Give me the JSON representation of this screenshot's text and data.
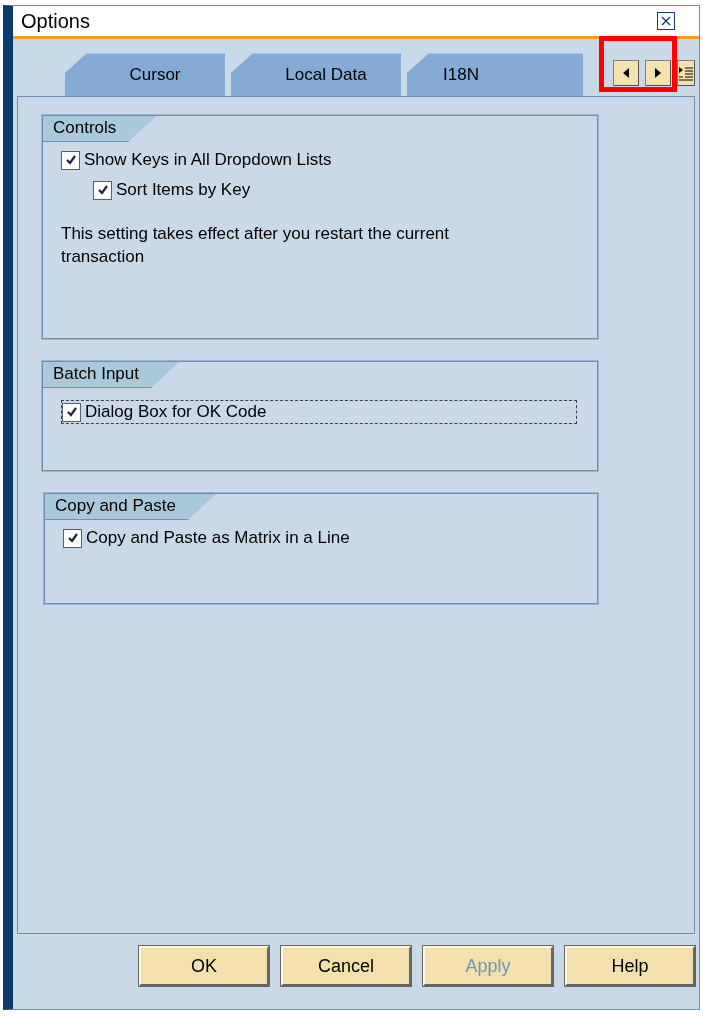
{
  "window": {
    "title": "Options"
  },
  "tabs": [
    {
      "label": "Cursor",
      "selected": false
    },
    {
      "label": "Local Data",
      "selected": false
    },
    {
      "label": "I18N",
      "selected": false
    }
  ],
  "highlight": {
    "kind": "frame"
  },
  "groups": [
    {
      "title": "Controls",
      "items": [
        {
          "kind": "checkbox",
          "label": "Show Keys in All Dropdown Lists",
          "checked": true,
          "focused": false,
          "children": [
            {
              "kind": "checkbox",
              "label": "Sort Items by Key",
              "checked": true,
              "focused": false
            }
          ]
        },
        {
          "kind": "note",
          "text": "This setting takes effect after you restart the current transaction"
        }
      ]
    },
    {
      "title": "Batch Input",
      "items": [
        {
          "kind": "checkbox",
          "label": "Dialog Box for OK Code",
          "checked": true,
          "focused": true
        }
      ]
    },
    {
      "title": "Copy and Paste",
      "items": [
        {
          "kind": "checkbox",
          "label": "Copy and Paste as Matrix in a Line",
          "checked": true,
          "focused": false
        }
      ]
    }
  ],
  "buttons": [
    {
      "label": "OK",
      "disabled": false
    },
    {
      "label": "Cancel",
      "disabled": false
    },
    {
      "label": "Apply",
      "disabled": true
    },
    {
      "label": "Help",
      "disabled": false
    }
  ]
}
